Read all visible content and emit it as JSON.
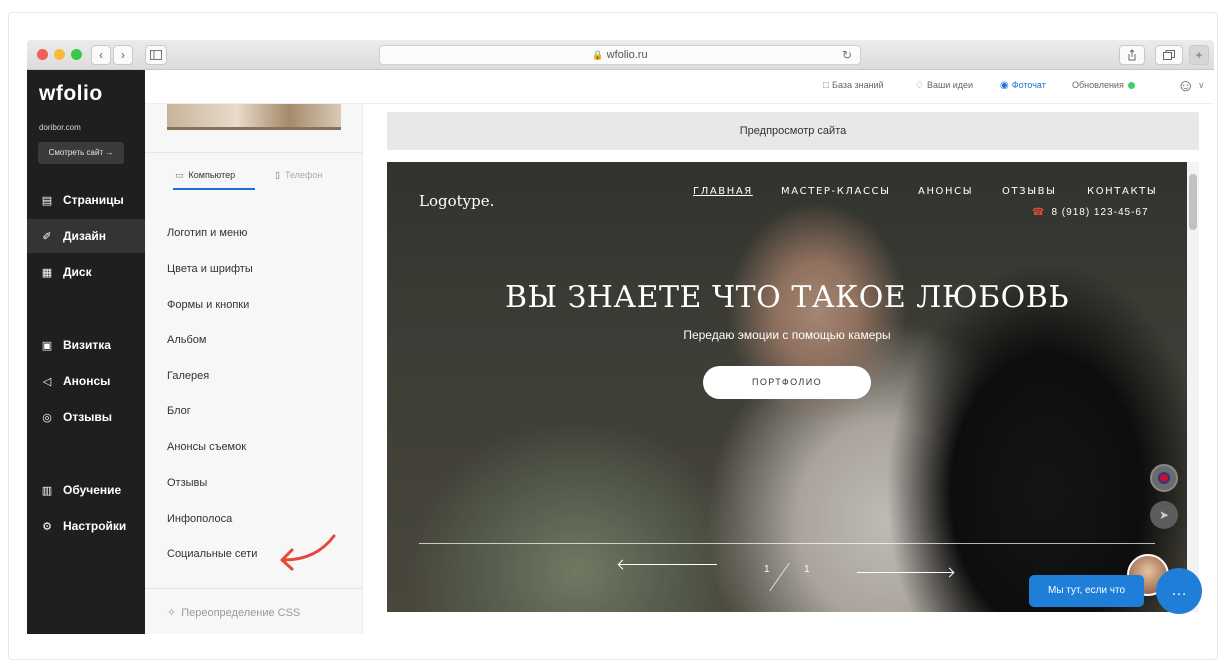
{
  "browser": {
    "url": "wfolio.ru",
    "lock_icon": "lock-icon",
    "nav_back": "‹",
    "nav_forward": "›"
  },
  "sidebar": {
    "logo": "wfolio",
    "domain": "doribor.com",
    "view_site_label": "Смотреть сайт →",
    "items": [
      {
        "label": "Страницы",
        "icon": "page-icon"
      },
      {
        "label": "Дизайн",
        "icon": "brush-icon",
        "active": true
      },
      {
        "label": "Диск",
        "icon": "disk-icon"
      },
      {
        "label": "Визитка",
        "icon": "id-card-icon"
      },
      {
        "label": "Анонсы",
        "icon": "megaphone-icon"
      },
      {
        "label": "Отзывы",
        "icon": "chat-icon"
      },
      {
        "label": "Обучение",
        "icon": "book-icon"
      },
      {
        "label": "Настройки",
        "icon": "gear-icon"
      }
    ]
  },
  "topbar": {
    "knowledge_base": "База знаний",
    "your_ideas": "Ваши идеи",
    "photochat": "Фоточат",
    "updates": "Обновления"
  },
  "panel": {
    "tabs": [
      {
        "label": "Компьютер",
        "icon": "monitor-icon",
        "active": true
      },
      {
        "label": "Телефон",
        "icon": "phone-icon",
        "active": false
      }
    ],
    "menu_items": [
      "Логотип и меню",
      "Цвета и шрифты",
      "Формы и кнопки",
      "Альбом",
      "Галерея",
      "Блог",
      "Анонсы съемок",
      "Отзывы",
      "Инфополоса",
      "Социальные сети"
    ],
    "css_override": "Переопределение CSS"
  },
  "preview": {
    "header": "Предпросмотр сайта",
    "site": {
      "logo": "Logotype.",
      "nav": [
        "ГЛАВНАЯ",
        "МАСТЕР-КЛАССЫ",
        "АНОНСЫ",
        "ОТЗЫВЫ",
        "КОНТАКТЫ"
      ],
      "phone": "8 (918) 123-45-67",
      "title": "ВЫ ЗНАЕТЕ ЧТО ТАКОЕ ЛЮБОВЬ",
      "subtitle": "Передаю эмоции с помощью камеры",
      "button": "ПОРТФОЛИО",
      "slide_current": "1",
      "slide_total": "1"
    }
  },
  "chat": {
    "bubble": "Мы тут, если что"
  },
  "colors": {
    "sidebar_bg": "#1f1f1f",
    "accent_blue": "#1f7ed8",
    "annotation_red": "#e8453c"
  }
}
